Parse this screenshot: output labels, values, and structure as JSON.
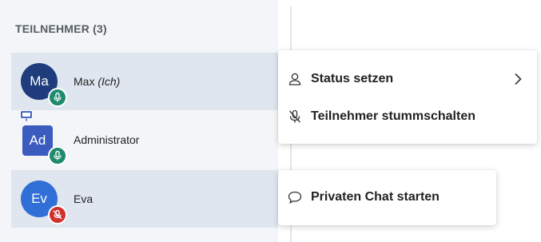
{
  "participants": {
    "header": "TEILNEHMER (3)",
    "items": [
      {
        "initials": "Ma",
        "name": "Max",
        "suffix": "(Ich)",
        "avatar_color": "#1f3c7d",
        "mic_status": "on",
        "badge_color": "#1f8a6d"
      },
      {
        "initials": "Ad",
        "name": "Administrator",
        "avatar_color": "#3b5bbf",
        "mic_status": "on",
        "badge_color": "#1f8a6d",
        "presenter_icon": "presentation-icon"
      },
      {
        "initials": "Ev",
        "name": "Eva",
        "avatar_color": "#2f6fd6",
        "mic_status": "muted",
        "badge_color": "#d2302c"
      }
    ]
  },
  "context_menu": {
    "items": [
      {
        "icon": "person-icon",
        "label": "Status setzen",
        "has_submenu": true
      },
      {
        "icon": "mic-muted-icon",
        "label": "Teilnehmer stummschalten"
      }
    ]
  },
  "chat_menu": {
    "items": [
      {
        "icon": "chat-bubble-icon",
        "label": "Privaten Chat starten"
      }
    ]
  }
}
